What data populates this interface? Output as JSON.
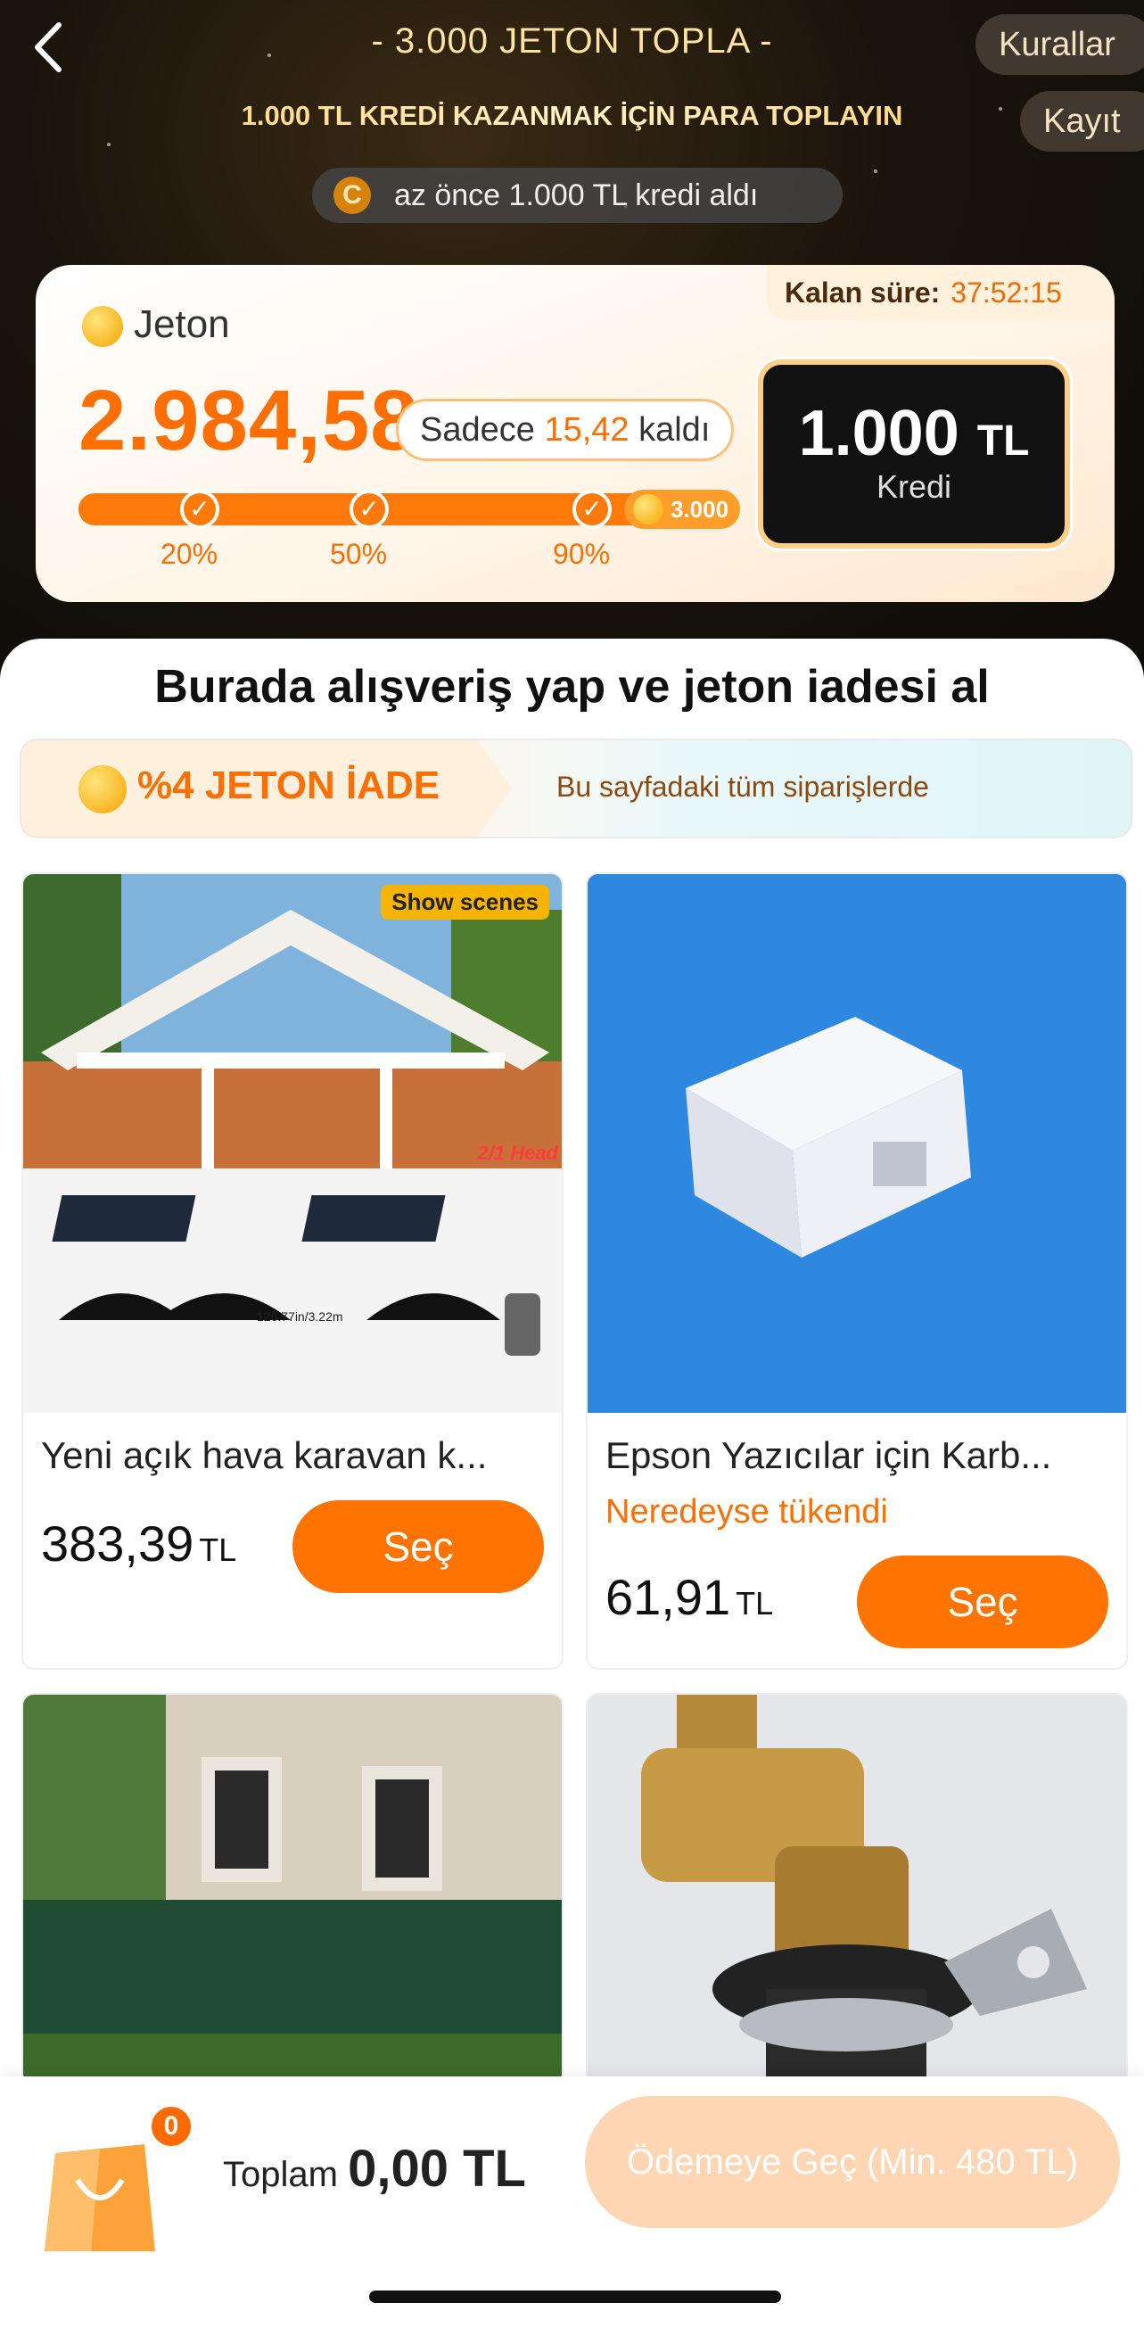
{
  "header": {
    "title": "- 3.000 JETON TOPLA -",
    "subtitle": "1.000 TL KREDİ KAZANMAK İÇİN PARA TOPLAYIN",
    "rules_label": "Kurallar",
    "record_label": "Kayıt",
    "recent_coin": "C",
    "recent_text": "az önce 1.000 TL kredi aldı"
  },
  "progress_card": {
    "timer_label": "Kalan süre:",
    "timer_value": "37:52:15",
    "coin_label": "Jeton",
    "amount": "2.984,58",
    "remaining_prefix": "Sadece",
    "remaining_value": "15,42",
    "remaining_suffix": "kaldı",
    "progress_fraction": 0.9949,
    "milestones": [
      "20%",
      "50%",
      "90%"
    ],
    "goal": "3.000",
    "reward_amount": "1.000",
    "reward_currency": "TL",
    "reward_type": "Kredi"
  },
  "panel": {
    "title": "Burada alışveriş yap ve jeton iadesi al",
    "promo_badge": "%4 JETON İADE",
    "promo_text": "Bu sayfadaki tüm siparişlerde"
  },
  "products": [
    {
      "name": "Yeni açık hava karavan k...",
      "status": "",
      "price": "383,39",
      "currency": "TL",
      "button": "Seç",
      "tag": "Show scenes",
      "img_note": "2/1 Head",
      "img_label": "126.77in/3.22m"
    },
    {
      "name": "Epson Yazıcılar için Karb...",
      "status": "Neredeyse tükendi",
      "price": "61,91",
      "currency": "TL",
      "button": "Seç"
    }
  ],
  "footer": {
    "cart_count": "0",
    "total_label": "Toplam",
    "total_value": "0,00 TL",
    "checkout_label": "Ödemeye Geç (Min. 480 TL)"
  },
  "colors": {
    "accent": "#ff7400",
    "hero_bg": "#120e09",
    "gold": "#ffd980"
  }
}
